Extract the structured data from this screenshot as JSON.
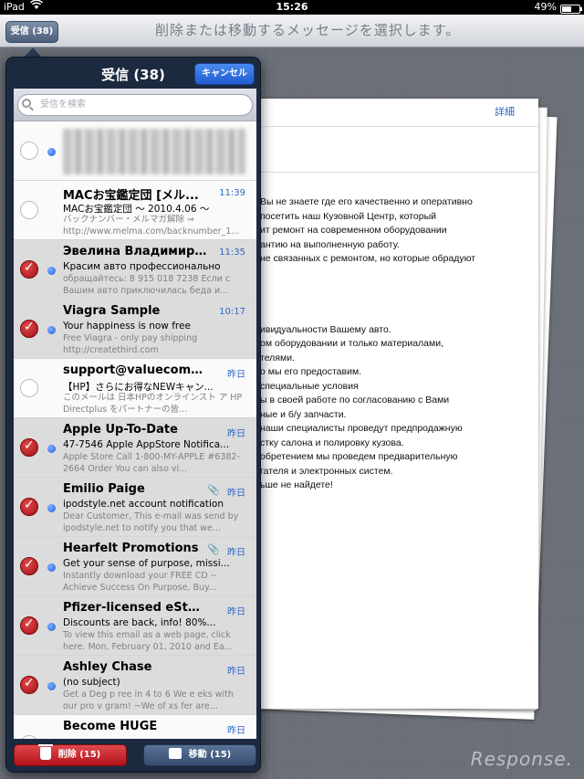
{
  "status_bar": {
    "device": "iPad",
    "wifi_icon": "wifi-icon",
    "time": "15:26",
    "battery": "49%",
    "battery_level": 0.49
  },
  "toolbar": {
    "inbox_button": "受信 (38)",
    "prompt": "削除または移動するメッセージを選択します。"
  },
  "popover": {
    "title": "受信 (38)",
    "cancel": "キャンセル",
    "search_placeholder": "受信を検索",
    "messages": [
      {
        "sender": "",
        "time": "",
        "subject": "",
        "preview": "",
        "selected": false,
        "unread": true,
        "blurred": true
      },
      {
        "sender": "MACお宝鑑定団 [メル...",
        "time": "11:39",
        "subject": "MACお宝鑑定団 〜 2010.4.06 〜",
        "preview": "バックナンバー・メルマガ解除 ⇒ http://www.melma.com/backnumber_1...",
        "selected": false,
        "unread": false
      },
      {
        "sender": "Эвелина Владимир...",
        "time": "11:35",
        "subject": "Красим авто профессионально",
        "preview": "обращайтесь: 8 915 018 7238 Если с Вашим авто приключилась беда и...",
        "selected": true,
        "unread": true
      },
      {
        "sender": "Viagra Sample",
        "time": "10:17",
        "subject": "Your happiness is now free",
        "preview": "Free Viagra - only pay shipping http://createthird.com",
        "selected": true,
        "unread": true
      },
      {
        "sender": "support@valuecomm...",
        "time": "昨日",
        "subject": "【HP】さらにお得なNEWキャン...",
        "preview": "このメールは 日本HPのオンラインスト ア HP Directplus をパートナーの皆...",
        "selected": false,
        "unread": false
      },
      {
        "sender": "Apple Up-To-Date",
        "time": "昨日",
        "subject": "47-7546 Apple AppStore Notifica...",
        "preview": "Apple Store Call 1-800-MY-APPLE #6382-2664 Order You can also vi...",
        "selected": true,
        "unread": true
      },
      {
        "sender": "Emilio Paige",
        "time": "昨日",
        "subject": "ipodstyle.net account notification",
        "preview": "Dear Customer, This e-mail was send by ipodstyle.net to notify you that we...",
        "selected": true,
        "unread": true,
        "attachment": true
      },
      {
        "sender": "Hearfelt Promotions",
        "time": "昨日",
        "subject": "Get your sense of purpose, missi...",
        "preview": "Instantly download your FREE CD -- Achieve Success On Purpose, Buy...",
        "selected": true,
        "unread": true,
        "attachment": true
      },
      {
        "sender": "Pfizer-licensed eStore",
        "time": "昨日",
        "subject": "Discounts are back, info! 80%...",
        "preview": "To view this email as a web page, click here. Mon, February 01, 2010 and Ea...",
        "selected": true,
        "unread": true
      },
      {
        "sender": "Ashley Chase",
        "time": "昨日",
        "subject": "(no subject)",
        "preview": "Get a Deg p ree in 4 to 6 We e eks with our pro v gram! ~We of xs fer are...",
        "selected": true,
        "unread": true
      },
      {
        "sender": "Become HUGE",
        "time": "昨日",
        "subject": "",
        "preview": "",
        "selected": false,
        "unread": false
      }
    ],
    "delete_button": "削除 (15)",
    "move_button": "移動 (15)"
  },
  "detail": {
    "link": "詳細",
    "body_lines": [
      "Вы не знаете где его качественно и оперативно",
      "посетить наш Кузовной Центр, который",
      "ит ремонт на современном оборудовании",
      "антию на выполненную работу.",
      "не связанных с ремонтом, но которые обрадуют",
      "",
      "",
      "",
      "",
      "ивидуальности Вашему авто.",
      "ом оборудовании и только материалами,",
      "телями.",
      "о мы его предоставим.",
      "специальные условия",
      "ы в своей работе по согласованию с Вами",
      "ные и б/у запчасти.",
      "наши специалисты проведут предпродажную",
      "стку салона и полировку кузова.",
      "обретением мы проведем предварительную",
      "гателя и электронных систем.",
      "ьше не найдете!"
    ]
  },
  "watermark": "Response."
}
